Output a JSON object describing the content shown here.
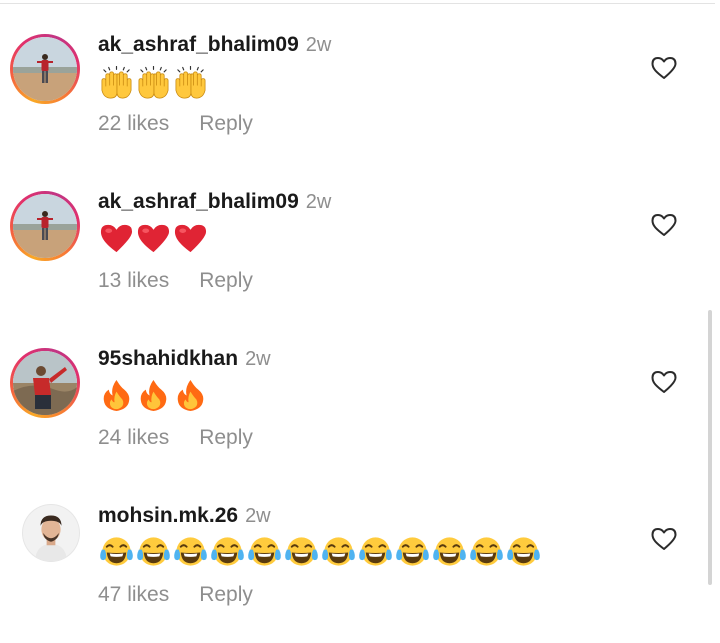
{
  "comments": [
    {
      "username": "ak_ashraf_bhalim09",
      "time": "2w",
      "emoji": "🙌🙌🙌",
      "likes": "22 likes",
      "reply": "Reply",
      "avatar": "person-standing-outdoors",
      "emoji_icon": "raising-hands-icon"
    },
    {
      "username": "ak_ashraf_bhalim09",
      "time": "2w",
      "emoji": "❤️❤️❤️",
      "likes": "13 likes",
      "reply": "Reply",
      "avatar": "person-standing-outdoors",
      "emoji_icon": "red-heart-icon"
    },
    {
      "username": "95shahidkhan",
      "time": "2w",
      "emoji": "🔥🔥🔥",
      "likes": "24 likes",
      "reply": "Reply",
      "avatar": "person-red-shirt-pointing",
      "emoji_icon": "fire-icon"
    },
    {
      "username": "mohsin.mk.26",
      "time": "2w",
      "emoji": "😂😂😂😂😂😂😂😂😂😂😂😂",
      "likes": "47 likes",
      "reply": "Reply",
      "avatar": "man-portrait",
      "emoji_icon": "tears-of-joy-icon"
    }
  ],
  "icons": {
    "like": "heart-outline-icon"
  },
  "colors": {
    "username": "#1a1a1a",
    "secondary_text": "#8e8e8e",
    "story_ring": [
      "#f9a825",
      "#e1306c",
      "#c13584"
    ],
    "heart_red": "#e02434",
    "fire_orange": "#ff7a1a",
    "emoji_yellow": "#ffcb3d"
  }
}
